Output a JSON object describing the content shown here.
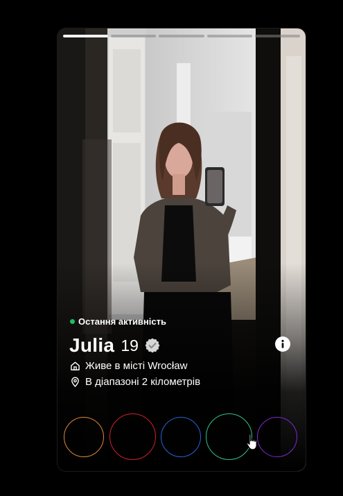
{
  "profile": {
    "status_text": "Остання активність",
    "status_color": "#1fbd63",
    "name": "Julia",
    "age": "19",
    "city": "Живе в місті Wrocław",
    "distance": "В діапазоні 2 кілометрів"
  },
  "photos": {
    "count": 5,
    "current": 1
  },
  "icons": {
    "verified": "verified-badge-icon",
    "info": "info-icon",
    "home": "home-icon",
    "location": "location-pin-icon"
  },
  "actions": [
    {
      "name": "rewind-button",
      "color": "#e08a33"
    },
    {
      "name": "nope-button",
      "color": "#d1202f"
    },
    {
      "name": "super-like-button",
      "color": "#2b63d9"
    },
    {
      "name": "like-button",
      "color": "#2fc48a"
    },
    {
      "name": "boost-button",
      "color": "#7c2bd6"
    }
  ]
}
